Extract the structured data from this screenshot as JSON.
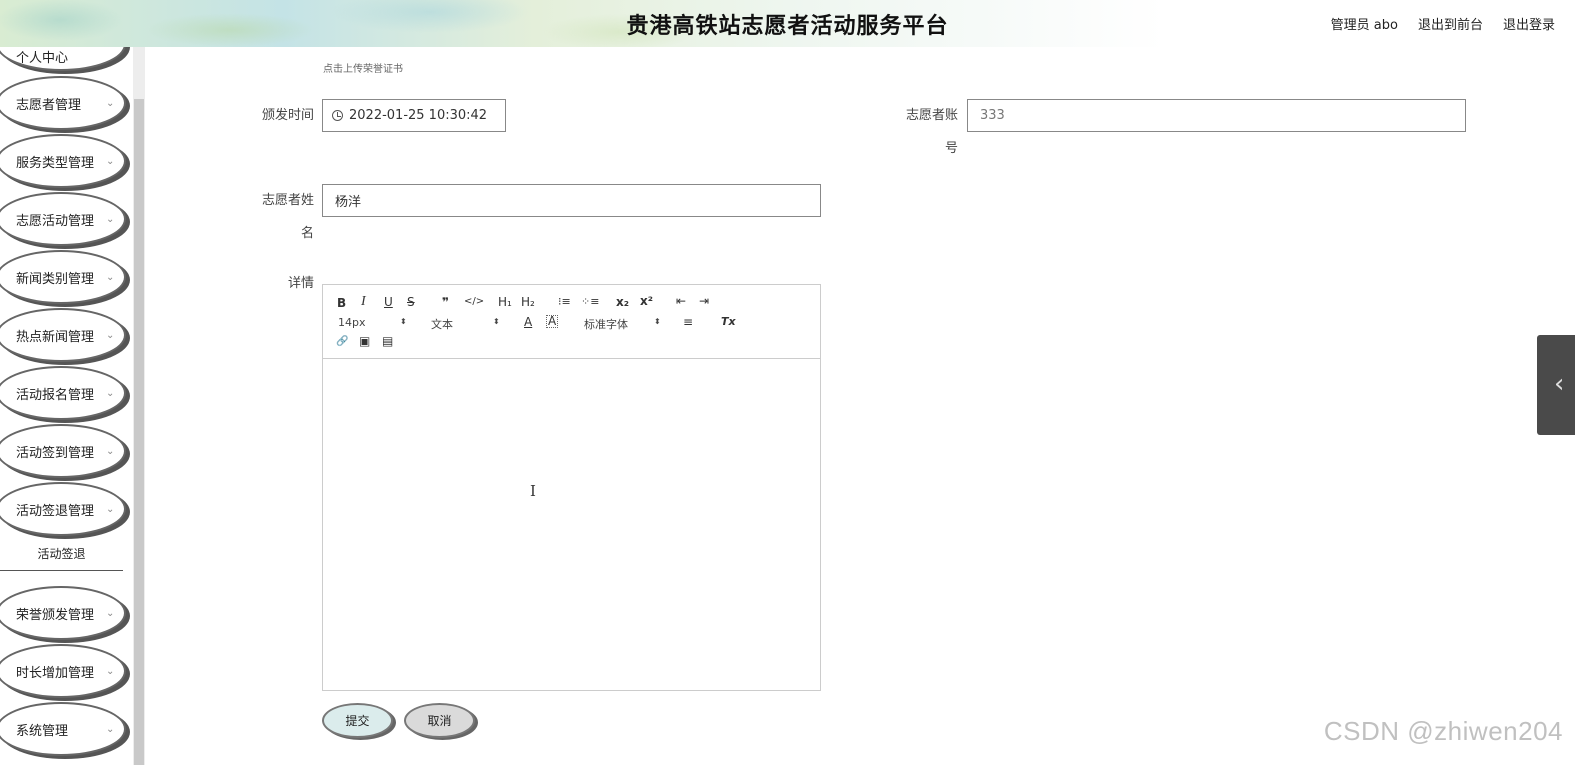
{
  "header": {
    "title": "贵港高铁站志愿者活动服务平台",
    "user_label": "管理员 abo",
    "front_link": "退出到前台",
    "logout_link": "退出登录"
  },
  "sidebar": {
    "items": [
      {
        "label": "个人中心"
      },
      {
        "label": "志愿者管理"
      },
      {
        "label": "服务类型管理"
      },
      {
        "label": "志愿活动管理"
      },
      {
        "label": "新闻类别管理"
      },
      {
        "label": "热点新闻管理"
      },
      {
        "label": "活动报名管理"
      },
      {
        "label": "活动签到管理"
      },
      {
        "label": "活动签退管理"
      },
      {
        "label": "荣誉颁发管理"
      },
      {
        "label": "时长增加管理"
      },
      {
        "label": "系统管理"
      }
    ],
    "submenu": {
      "label": "活动签退"
    },
    "chevron": "⌄"
  },
  "form": {
    "upload_hint": "点击上传荣誉证书",
    "issue_time": {
      "label": "颁发时间",
      "value": "2022-01-25 10:30:42"
    },
    "volunteer_account": {
      "label": "志愿者账号",
      "value": "333"
    },
    "volunteer_name": {
      "label": "志愿者姓名",
      "value": "杨洋"
    },
    "details": {
      "label": "详情"
    }
  },
  "editor": {
    "toolbar": {
      "bold": "B",
      "italic": "I",
      "underline": "U",
      "strike": "S",
      "quote": "❞",
      "code": "</>",
      "h1": "H₁",
      "h2": "H₂",
      "ordered_list": "⁝≡",
      "bullet_list": "⁘≡",
      "subscript": "x₂",
      "superscript": "x²",
      "outdent": "⇤",
      "indent": "⇥",
      "font_size": "14px",
      "paragraph": "文本",
      "font_color": "A",
      "bg_color": "A",
      "font_family": "标准字体",
      "align": "≡",
      "clear": "Tx",
      "link": "🔗",
      "image": "▣",
      "video": "▤",
      "select_arrow": "⬍"
    },
    "cursor": "I"
  },
  "buttons": {
    "submit": "提交",
    "cancel": "取消"
  },
  "side_tab": {
    "icon": "‹"
  },
  "watermark": "CSDN @zhiwen204"
}
